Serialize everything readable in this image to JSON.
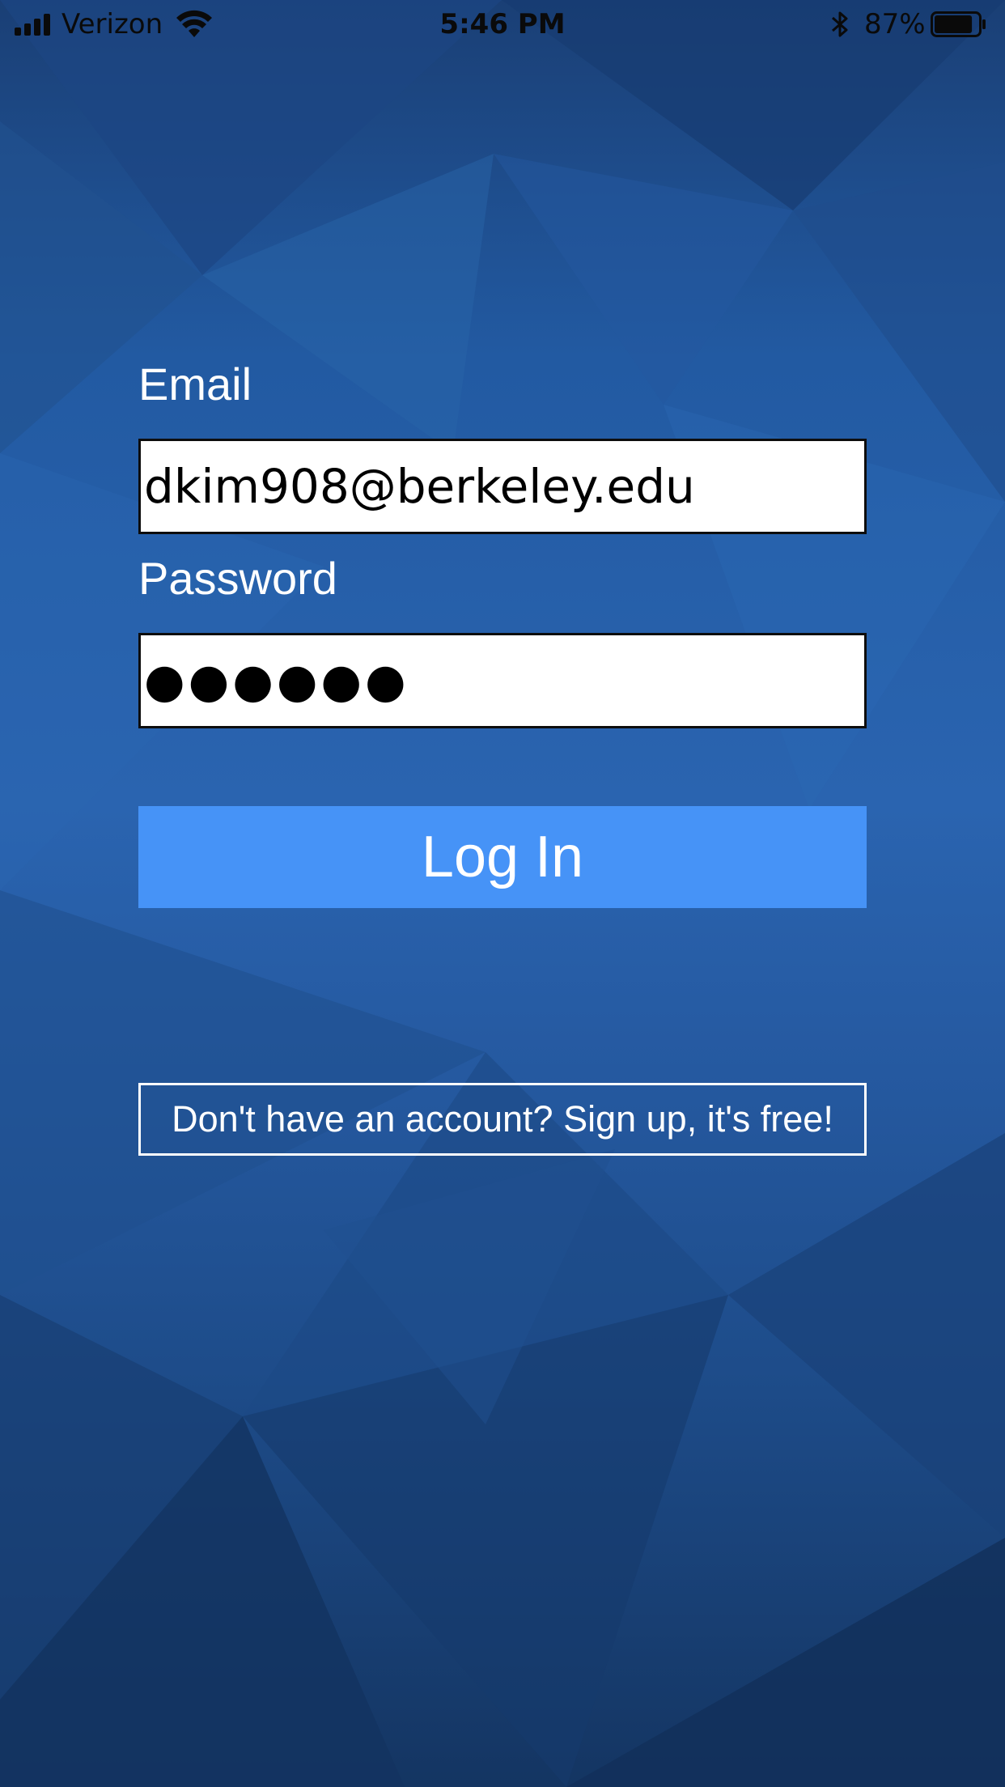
{
  "status_bar": {
    "carrier": "Verizon",
    "time": "5:46 PM",
    "battery_percent": "87%",
    "battery_level": 0.87,
    "icons": [
      "signal-icon",
      "wifi-icon",
      "bluetooth-icon",
      "battery-icon"
    ]
  },
  "login_form": {
    "email_label": "Email",
    "email_value": "dkim908@berkeley.edu",
    "password_label": "Password",
    "password_value": "●●●●●●",
    "login_button_label": "Log In",
    "signup_link_label": "Don't have an account? Sign up, it's free!"
  },
  "colors": {
    "background": "#2a64b0",
    "login_button": "#4693f7",
    "text_light": "#ffffff"
  }
}
